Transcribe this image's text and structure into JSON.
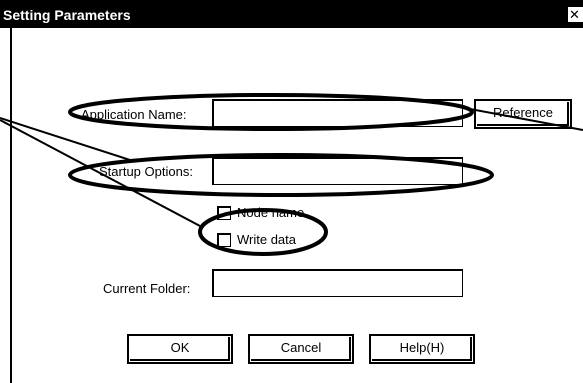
{
  "window": {
    "title": "Setting Parameters",
    "close_glyph": "✕"
  },
  "form": {
    "application_name_label": "Application Name:",
    "application_name_value": "",
    "reference_label": "Reference",
    "startup_options_label": "Startup Options:",
    "startup_options_value": "",
    "node_name_label": "Node name",
    "write_data_label": "Write data",
    "current_folder_label": "Current Folder:",
    "current_folder_value": ""
  },
  "buttons": {
    "ok_label": "OK",
    "cancel_label": "Cancel",
    "help_label": "Help(H)"
  }
}
